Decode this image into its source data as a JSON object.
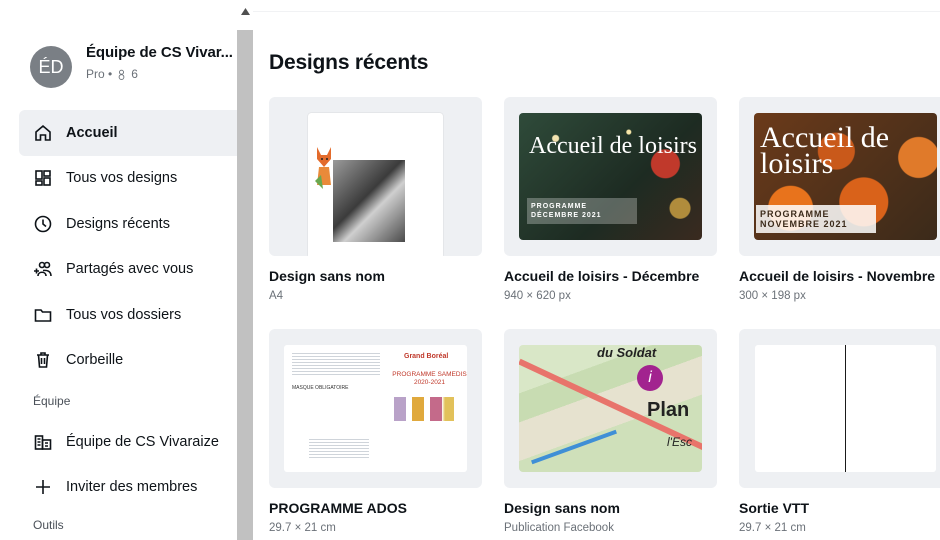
{
  "team": {
    "avatar_initials": "ÉD",
    "name": "Équipe de CS Vivar...",
    "plan": "Pro •",
    "members": "6"
  },
  "nav": {
    "items": [
      {
        "label": "Accueil",
        "icon": "home-icon",
        "active": true
      },
      {
        "label": "Tous vos designs",
        "icon": "grid-icon"
      },
      {
        "label": "Designs récents",
        "icon": "clock-icon"
      },
      {
        "label": "Partagés avec vous",
        "icon": "shared-users-icon"
      },
      {
        "label": "Tous vos dossiers",
        "icon": "folder-icon"
      },
      {
        "label": "Corbeille",
        "icon": "trash-icon"
      }
    ],
    "section_team": "Équipe",
    "team_items": [
      {
        "label": "Équipe de CS Vivaraize",
        "icon": "team-icon"
      },
      {
        "label": "Inviter des membres",
        "icon": "plus-icon"
      }
    ],
    "section_tools": "Outils"
  },
  "main": {
    "title": "Designs récents",
    "designs": [
      {
        "title": "Design sans nom",
        "subtitle": "A4"
      },
      {
        "title": "Accueil de loisirs - Décembre",
        "subtitle": "940 × 620 px",
        "poster_title": "Accueil de loisirs",
        "poster_band": "PROGRAMME DÉCEMBRE 2021"
      },
      {
        "title": "Accueil de loisirs - Novembre",
        "subtitle": "300 × 198 px",
        "poster_title": "Accueil de loisirs",
        "poster_band": "PROGRAMME NOVEMBRE 2021"
      },
      {
        "title": "PROGRAMME ADOS",
        "subtitle": "29.7 × 21 cm",
        "flyer_head": "Grand Boréal",
        "flyer_prog": "PROGRAMME SAMEDIS 2020-2021",
        "flyer_mask": "MASQUE OBLIGATOIRE"
      },
      {
        "title": "Design sans nom",
        "subtitle": "Publication Facebook",
        "map_l1": "du Soldat",
        "map_l2": "Plan",
        "map_l3": "l'Esc"
      },
      {
        "title": "Sortie VTT",
        "subtitle": "29.7 × 21 cm"
      }
    ]
  },
  "colors": {
    "active_bg": "#eef0f3",
    "thumb_bg": "#eef0f3",
    "scrollbar": "#c1c1c1",
    "text": "#0e1318",
    "muted": "#6b7178"
  }
}
